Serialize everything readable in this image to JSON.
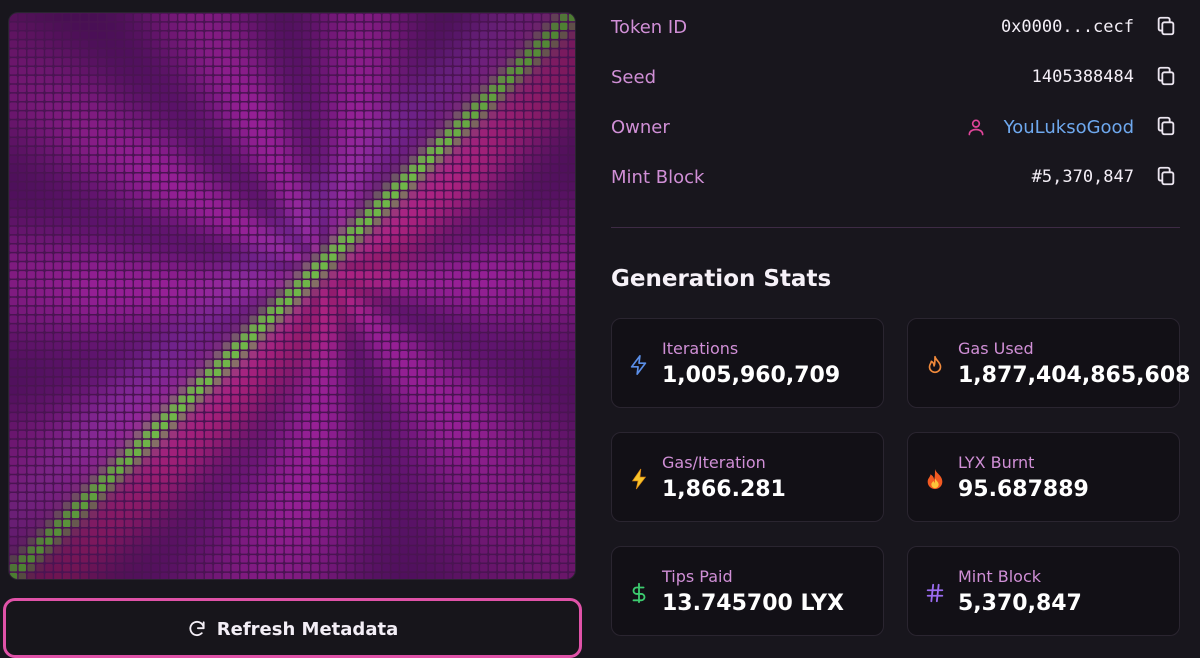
{
  "artwork": {
    "alt": "Generated pixel artwork"
  },
  "refresh_button": {
    "label": "Refresh Metadata"
  },
  "details": {
    "token_id": {
      "label": "Token ID",
      "value": "0x0000...cecf"
    },
    "seed": {
      "label": "Seed",
      "value": "1405388484"
    },
    "owner": {
      "label": "Owner",
      "value": "YouLuksoGood"
    },
    "mint_block": {
      "label": "Mint Block",
      "value": "#5,370,847"
    }
  },
  "generation_stats": {
    "title": "Generation Stats",
    "cards": [
      {
        "label": "Iterations",
        "value": "1,005,960,709",
        "icon": "lightning-outline-icon",
        "icon_color": "#5b8fe8"
      },
      {
        "label": "Gas Used",
        "value": "1,877,404,865,608",
        "icon": "flame-outline-icon",
        "icon_color": "#f08a3c"
      },
      {
        "label": "Gas/Iteration",
        "value": "1,866.281",
        "icon": "lightning-emoji-icon",
        "icon_color": "#f7c52b"
      },
      {
        "label": "LYX Burnt",
        "value": "95.687889",
        "icon": "fire-emoji-icon",
        "icon_color": "#f35a22"
      },
      {
        "label": "Tips Paid",
        "value": "13.745700 LYX",
        "icon": "dollar-icon",
        "icon_color": "#3ccb6f"
      },
      {
        "label": "Mint Block",
        "value": "5,370,847",
        "icon": "hash-icon",
        "icon_color": "#9b6cf0"
      }
    ]
  },
  "colors": {
    "background": "#18161d",
    "label_pink": "#d08fd6",
    "link_blue": "#6ea8ee",
    "button_border": "#e052a8",
    "owner_icon": "#e0459a"
  }
}
